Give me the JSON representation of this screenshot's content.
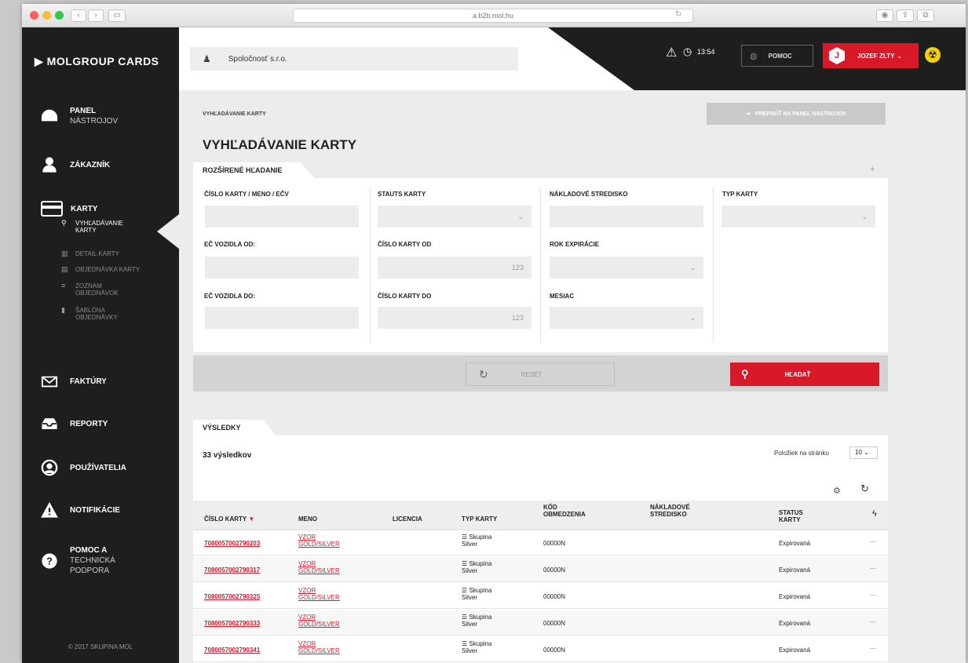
{
  "browser": {
    "url": "a.b2b.mol.hu"
  },
  "brand": {
    "logo": "MOLGROUP CARDS",
    "accent": "#d7192a",
    "dark": "#1e1e1e"
  },
  "sidebar": {
    "items": [
      {
        "label": "PANEL",
        "label2": "NÁSTROJOV",
        "icon": "dashboard-icon"
      },
      {
        "label": "ZÁKAZNÍK",
        "icon": "user-icon"
      },
      {
        "label": "KARTY",
        "icon": "card-icon"
      },
      {
        "label": "FAKTÚRY",
        "icon": "envelope-icon"
      },
      {
        "label": "REPORTY",
        "icon": "inbox-icon"
      },
      {
        "label": "POUŽÍVATELIA",
        "icon": "users-icon"
      },
      {
        "label": "NOTIFIKÁCIE",
        "icon": "warning-icon"
      },
      {
        "label": "POMOC A",
        "label2": "TECHNICKÁ",
        "label3": "PODPORA",
        "icon": "help-icon"
      }
    ],
    "subitems": [
      {
        "label": "VYHĽADÁVANIE",
        "label2": "KARTY",
        "active": true,
        "icon": "search-icon"
      },
      {
        "label": "DETAIL KARTY",
        "label2": "",
        "active": false,
        "icon": "bar-chart-icon"
      },
      {
        "label": "OBJEDNÁVKA KARTY",
        "label2": "",
        "active": false,
        "icon": "card-order-icon"
      },
      {
        "label": "ZOZNAM",
        "label2": "OBJEDNÁVOK",
        "active": false,
        "icon": "list-icon"
      },
      {
        "label": "ŠABLÓNA",
        "label2": "OBJEDNÁVKY",
        "active": false,
        "icon": "file-icon"
      }
    ],
    "copyright": "© 2017 SKUPINA MOL"
  },
  "header": {
    "company": "Spoločnosť s.r.o.",
    "time": "13:54",
    "help": "POMOC",
    "user_initial": "J",
    "user": "JOZEF ZLTY"
  },
  "page": {
    "breadcrumb": "VYHĽADÁVANIE KARTY",
    "back_button": "PREPNÚŤ NA PANEL NÁSTROJOV",
    "title": "VYHĽADÁVANIE KARTY"
  },
  "search": {
    "tab": "ROZŠÍRENÉ HĽADANIE",
    "labels": {
      "card_number": "ČÍSLO KARTY / MENO / EČV",
      "status": "STAUTS KARTY",
      "cost_center": "NÁKLADOVÉ STREDISKO",
      "card_type": "TYP KARTY",
      "vehicle_from": "EČ VOZIDLA OD:",
      "card_from": "ČÍSLO KARTY OD",
      "exp_year": "ROK EXPIRÁCIE",
      "vehicle_to": "EČ VOZIDLA DO:",
      "card_to": "ČÍSLO KARTY DO",
      "month": "MESIAC"
    },
    "card_from_value": "123",
    "card_to_value": "123",
    "reset": "RESET",
    "search": "HĽADAŤ"
  },
  "results": {
    "tab": "VÝSLEDKY",
    "count": "33 výsledkov",
    "per_page_label": "Položiek na stránku",
    "per_page": "10",
    "columns": {
      "card": "ČÍSLO KARTY",
      "name": "MENO",
      "license": "LICENCIA",
      "type": "TYP KARTY",
      "code1": "KÓD",
      "code2": "OBMEDZENIA",
      "cost1": "NÁKLADOVÉ",
      "cost2": "STREDISKO",
      "status1": "STATUS",
      "status2": "KARTY"
    },
    "rows": [
      {
        "card": "7080057002790203",
        "name1": "VZOR",
        "name2": "GOLD/SILVER",
        "type1": "Skupina",
        "type2": "Silver",
        "code": "00000N",
        "status": "Expirovaná"
      },
      {
        "card": "7080057002790317",
        "name1": "VZOR",
        "name2": "GOLD/SILVER",
        "type1": "Skupina",
        "type2": "Silver",
        "code": "00000N",
        "status": "Expirovaná"
      },
      {
        "card": "7080057002790325",
        "name1": "VZOR",
        "name2": "GOLD/SILVER",
        "type1": "Skupina",
        "type2": "Silver",
        "code": "00000N",
        "status": "Expirovaná"
      },
      {
        "card": "7080057002790333",
        "name1": "VZOR",
        "name2": "GOLD/SILVER",
        "type1": "Skupina",
        "type2": "Silver",
        "code": "00000N",
        "status": "Expirovaná"
      },
      {
        "card": "7080057002790341",
        "name1": "VZOR",
        "name2": "GOLD/SILVER",
        "type1": "Skupina",
        "type2": "Silver",
        "code": "00000N",
        "status": "Expirovaná"
      }
    ]
  }
}
